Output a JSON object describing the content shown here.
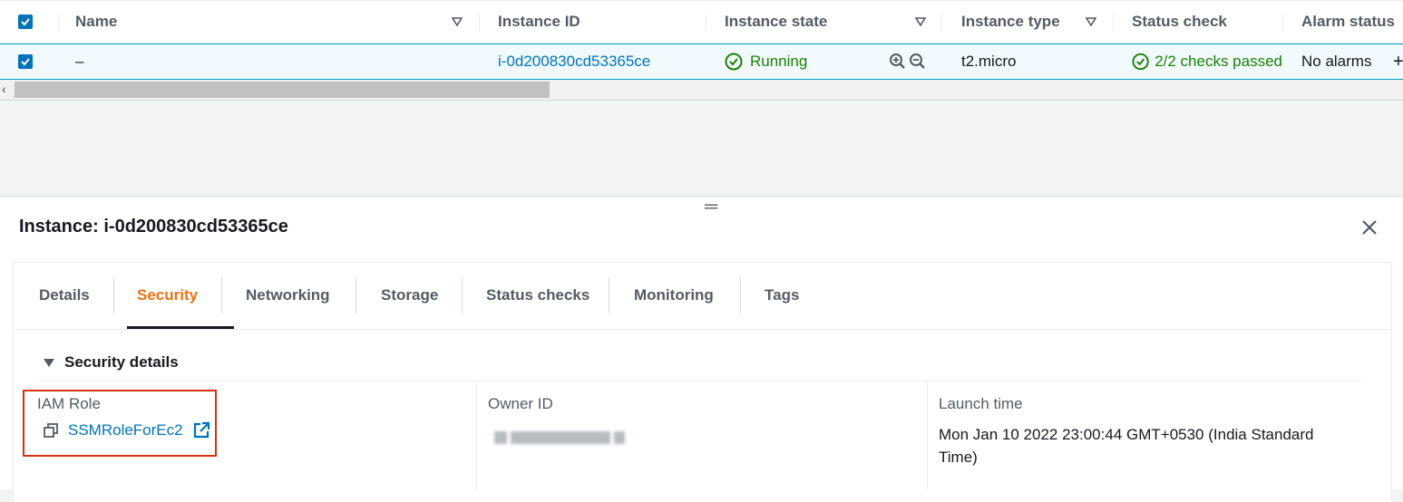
{
  "table": {
    "columns": [
      {
        "key": "name",
        "label": "Name"
      },
      {
        "key": "instance_id",
        "label": "Instance ID"
      },
      {
        "key": "instance_state",
        "label": "Instance state"
      },
      {
        "key": "instance_type",
        "label": "Instance type"
      },
      {
        "key": "status_check",
        "label": "Status check"
      },
      {
        "key": "alarm_status",
        "label": "Alarm status"
      }
    ],
    "row": {
      "name": "–",
      "instance_id": "i-0d200830cd53365ce",
      "instance_state": "Running",
      "instance_type": "t2.micro",
      "status_check": "2/2 checks passed",
      "alarm_status": "No alarms"
    }
  },
  "panel": {
    "title": "Instance: i-0d200830cd53365ce",
    "tabs": [
      "Details",
      "Security",
      "Networking",
      "Storage",
      "Status checks",
      "Monitoring",
      "Tags"
    ],
    "active_tab": "Security",
    "section_title": "Security details",
    "fields": {
      "iam_role": {
        "label": "IAM Role",
        "value": "SSMRoleForEc2"
      },
      "owner_id": {
        "label": "Owner ID"
      },
      "launch_time": {
        "label": "Launch time",
        "value_line1": "Mon Jan 10 2022 23:00:44 GMT+0530 (India Standard",
        "value_line2": "Time)"
      }
    }
  },
  "colors": {
    "link": "#0073bb",
    "success": "#1d8102",
    "active_tab": "#ec7211",
    "highlight": "#d13212"
  },
  "icons": [
    "checkbox-checked-icon",
    "sort-caret-icon",
    "success-check-icon",
    "zoom-in-icon",
    "zoom-out-icon",
    "close-icon",
    "collapse-caret-icon",
    "copy-icon",
    "external-link-icon"
  ]
}
